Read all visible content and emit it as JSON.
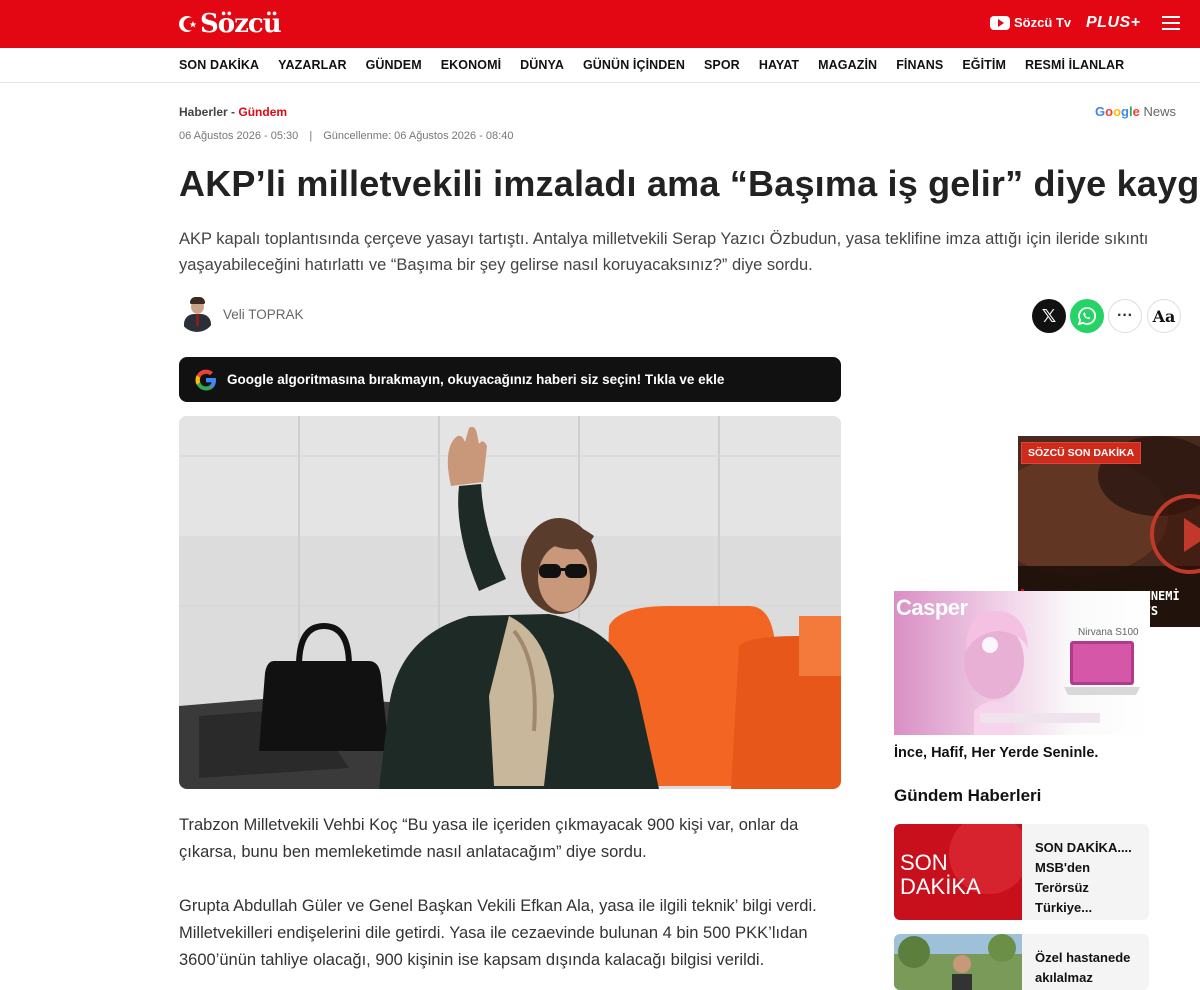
{
  "header": {
    "logo": "Sözcü",
    "tv_label": "Sözcü Tv",
    "plus_label": "PLUS+"
  },
  "nav": {
    "items": [
      "SON DAKİKA",
      "YAZARLAR",
      "GÜNDEM",
      "EKONOMİ",
      "DÜNYA",
      "GÜNÜN İÇİNDEN",
      "SPOR",
      "HAYAT",
      "MAGAZİN",
      "FİNANS",
      "EĞİTİM",
      "RESMİ İLANLAR"
    ]
  },
  "article": {
    "breadcrumb_root": "Haberler -",
    "breadcrumb_category": "Gündem",
    "published": "06 Ağustos 2026 - 05:30",
    "date_separator": "|",
    "updated": "Güncellenme: 06 Ağustos 2026 - 08:40",
    "google_news_g": "Google",
    "google_news_n": "News",
    "headline": "AKP’li milletvekili imzaladı ama “Başıma iş gelir” diye kaygılı",
    "lead": "AKP kapalı toplantısında çerçeve yasayı tartıştı. Antalya milletvekili Serap Yazıcı Özbudun, yasa teklifine imza attığı için ileride sıkıntı yaşayabileceğini hatırlattı ve “Başıma bir şey gelirse nasıl koruyacaksınız?” diye sordu.",
    "author": "Veli TOPRAK",
    "google_banner": "Google algoritmasına bırakmayın, okuyacağınız haberi siz seçin! Tıkla ve ekle",
    "paragraphs": [
      "Trabzon Milletvekili Vehbi Koç “Bu yasa ile içeriden çıkmayacak 900 kişi var, onlar da çıkarsa, bunu ben memleketimde nasıl anlatacağım” diye sordu.",
      "Grupta Abdullah Güler ve Genel Başkan Vekili Efkan Ala, yasa ile ilgili teknik’ bilgi verdi. Milletvekilleri endişelerini dile getirdi. Yasa ile cezaevinde bulunan 4 bin 500 PKK’lıdan 3600’ünün tahliye olacağı, 900 kişinin ise kapsam dışında kalacağı bilgisi verildi."
    ]
  },
  "share": {
    "x_icon": "x-logo-icon",
    "whatsapp_icon": "whatsapp-icon",
    "more_label": "···",
    "font_size_label": "Aa"
  },
  "sidebar": {
    "video_tag": "SÖZCÜ SON DAKİKA",
    "video_caption_line1": "ABD'DE ALEV CEHENNEMİ",
    "video_caption_line2": "TERK ETTİ! #SHORTS",
    "ad_brand": "Casper",
    "ad_model": "Nirvana S100",
    "ad_caption": "İnce, Hafif, Her Yerde Seninle.",
    "section_title": "Gündem Haberleri",
    "news": [
      {
        "thumb_line1": "SON",
        "thumb_line2": "DAKİKA",
        "title": "SON DAKİKA.... MSB'den Terörsüz Türkiye..."
      },
      {
        "title": "Özel hastanede akılalmaz skandal:"
      }
    ]
  },
  "colors": {
    "brand_red": "#e30613",
    "whatsapp_green": "#25d366",
    "banner_dark": "#111111"
  }
}
